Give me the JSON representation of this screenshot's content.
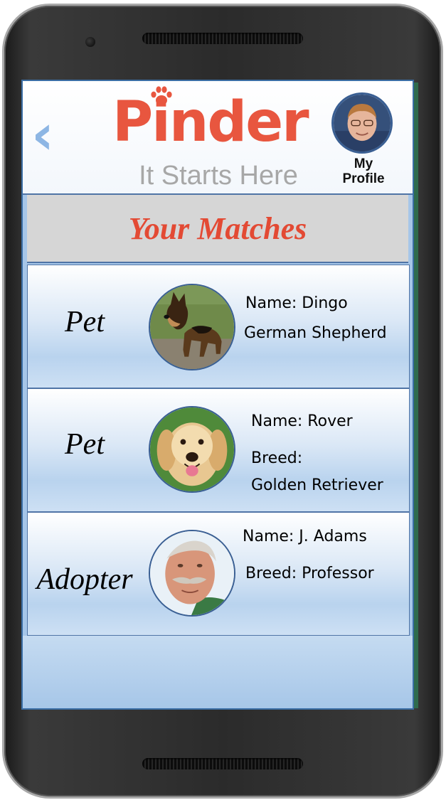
{
  "app": {
    "logo_text": "Pinder",
    "tagline": "It Starts Here",
    "back_icon": "chevron-left-icon",
    "profile_label_line1": "My",
    "profile_label_line2": "Profile"
  },
  "matches": {
    "title": "Your Matches",
    "rows": [
      {
        "type": "Pet",
        "line1": "Name: Dingo",
        "line2": "German Shepherd",
        "line3": ""
      },
      {
        "type": "Pet",
        "line1": "Name: Rover",
        "line2": "Breed:",
        "line3": "Golden Retriever"
      },
      {
        "type": "Adopter",
        "line1": "Name: J. Adams",
        "line2": "Breed: Professor",
        "line3": ""
      }
    ]
  },
  "colors": {
    "brand": "#e8563f",
    "title": "#e34a34",
    "accent_blue": "#8db6e4",
    "screen_bg": "#a6c6e8"
  }
}
